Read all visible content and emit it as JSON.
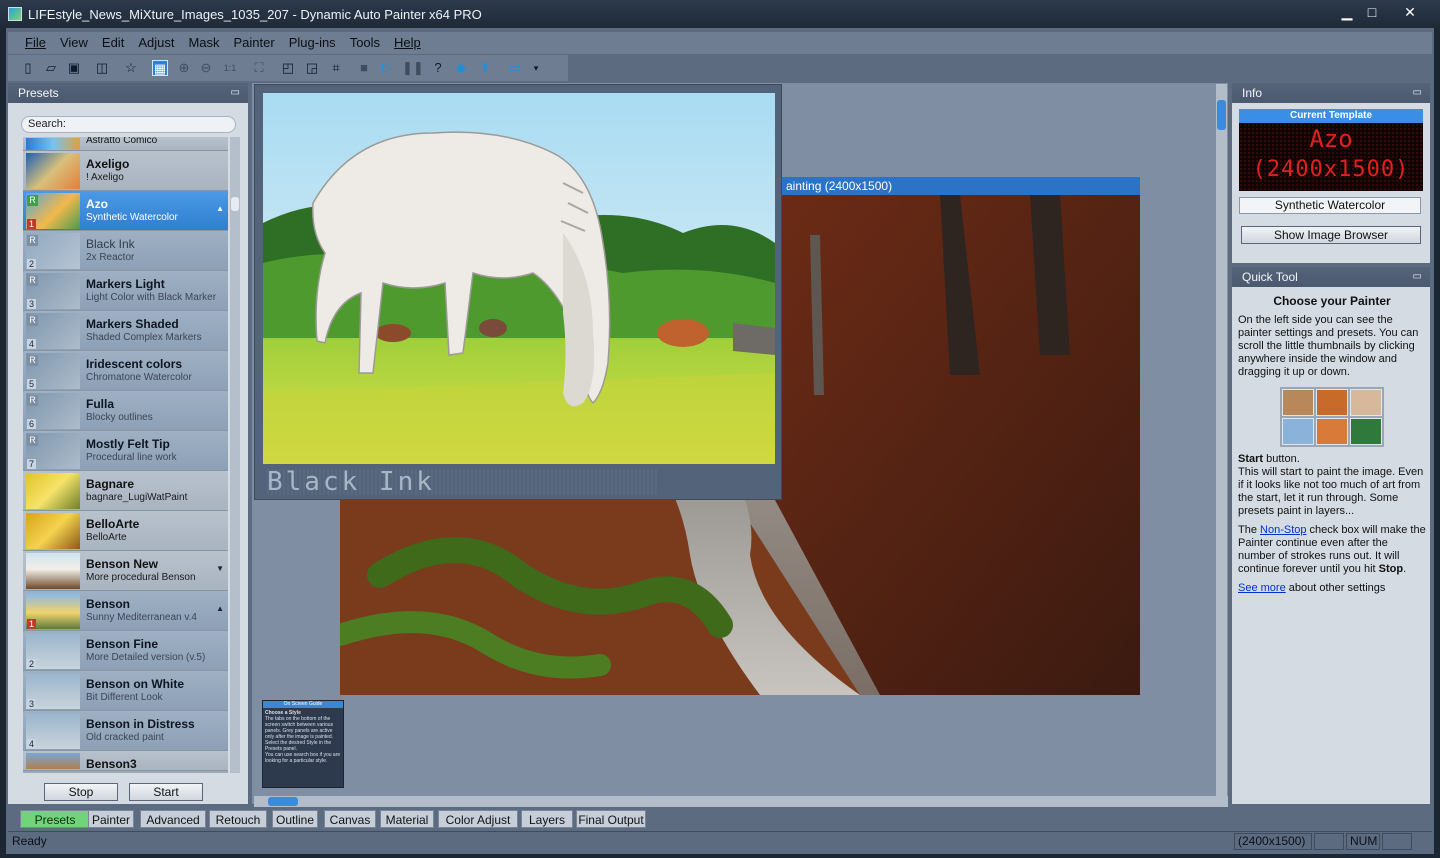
{
  "window": {
    "title": "LIFEstyle_News_MiXture_Images_1035_207 - Dynamic Auto Painter x64 PRO",
    "minimize": "▁",
    "maximize": "□",
    "close": "✕"
  },
  "menu": [
    "File",
    "View",
    "Edit",
    "Adjust",
    "Mask",
    "Painter",
    "Plug-ins",
    "Tools",
    "Help"
  ],
  "presets_panel": {
    "title": "Presets",
    "search_label": "Search:",
    "partial_top": "Astratto Comico",
    "items": [
      {
        "name": "Axeligo",
        "desc": "! Axeligo"
      },
      {
        "name": "Azo",
        "desc": "Synthetic Watercolor",
        "num": "1",
        "badge": "R",
        "expand": "▲"
      },
      {
        "name": "Black Ink",
        "desc": "2x Reactor",
        "num": "2",
        "badge": "R"
      },
      {
        "name": "Markers Light",
        "desc": "Light Color with Black Marker",
        "num": "3",
        "badge": "R"
      },
      {
        "name": "Markers Shaded",
        "desc": "Shaded Complex Markers",
        "num": "4",
        "badge": "R"
      },
      {
        "name": "Iridescent colors",
        "desc": "Chromatone Watercolor",
        "num": "5",
        "badge": "R"
      },
      {
        "name": "Fulla",
        "desc": "Blocky outlines",
        "num": "6",
        "badge": "R"
      },
      {
        "name": "Mostly Felt Tip",
        "desc": "Procedural line work",
        "num": "7",
        "badge": "R"
      },
      {
        "name": "Bagnare",
        "desc": "bagnare_LugiWatPaint"
      },
      {
        "name": "BelloArte",
        "desc": "BelloArte"
      },
      {
        "name": "Benson New",
        "desc": "More procedural Benson",
        "expand": "▼"
      },
      {
        "name": "Benson",
        "desc": "Sunny Mediterranean v.4",
        "num": "1",
        "expand": "▲"
      },
      {
        "name": "Benson Fine",
        "desc": "More Detailed version (v.5)",
        "num": "2"
      },
      {
        "name": "Benson on White",
        "desc": "Bit Different Look",
        "num": "3"
      },
      {
        "name": "Benson in Distress",
        "desc": "Old cracked paint",
        "num": "4"
      },
      {
        "name": "Benson3",
        "desc": ""
      }
    ],
    "stop_label": "Stop",
    "start_label": "Start"
  },
  "canvas": {
    "doc_title": "ainting (2400x1500)",
    "preview_label": "Black Ink"
  },
  "guide": {
    "title": "On Screen Guide",
    "heading": "Choose a Style",
    "text": "The tabs on the bottom of the screen switch between various panels. Grey panels are active only after the image is painted.",
    "text2": "Select the desired Style in the Presets panel.",
    "text3": "You can use search box if you are looking for a particular style."
  },
  "info_panel": {
    "title": "Info",
    "current_template_label": "Current Template",
    "led_line1": "Azo",
    "led_line2": "(2400x1500)",
    "template_value": "Synthetic Watercolor",
    "show_browser_label": "Show Image Browser"
  },
  "quick_tool": {
    "title": "Quick Tool",
    "heading": "Choose your Painter",
    "para1": "On the left side you can see the painter settings and presets. You can scroll the little thumbnails by clicking anywhere inside the window and dragging it up or down.",
    "start_bold": "Start",
    "start_suffix": " button.",
    "para2": "This will start to paint the image. Even if it looks like not too much of art from the start, let it run through. Some presets paint in layers...",
    "nonstop_prefix": "The ",
    "nonstop_link": "Non-Stop",
    "nonstop_text": " check box will make the Painter continue even after the number of strokes runs out. It will continue forever until you hit ",
    "stop_bold": "Stop",
    "stop_suffix": ".",
    "seemore_link": "See more",
    "seemore_text": " about other settings"
  },
  "tabs": [
    "Presets",
    "Painter",
    "Advanced",
    "Retouch",
    "Outline",
    "Canvas",
    "Material",
    "Color Adjust",
    "Layers",
    "Final Output"
  ],
  "active_tab": "Presets",
  "status": {
    "text": "Ready",
    "size": "(2400x1500)",
    "num": "NUM"
  },
  "colors": {
    "accent_blue": "#2f7fd0",
    "active_tab_green": "#6fd47a",
    "led_red": "#e02020"
  },
  "icons": [
    "new-file-icon",
    "open-folder-icon",
    "save-icon",
    "save-as-icon",
    "favorite-star-icon",
    "image-browser-icon",
    "zoom-in-icon",
    "zoom-out-icon",
    "actual-size-icon",
    "fit-window-icon",
    "layout-1-icon",
    "layout-2-icon",
    "crop-icon",
    "stop-icon",
    "play-icon",
    "pause-icon",
    "help-icon",
    "paint-icon",
    "upload-icon",
    "frame-icon",
    "overflow-icon"
  ]
}
